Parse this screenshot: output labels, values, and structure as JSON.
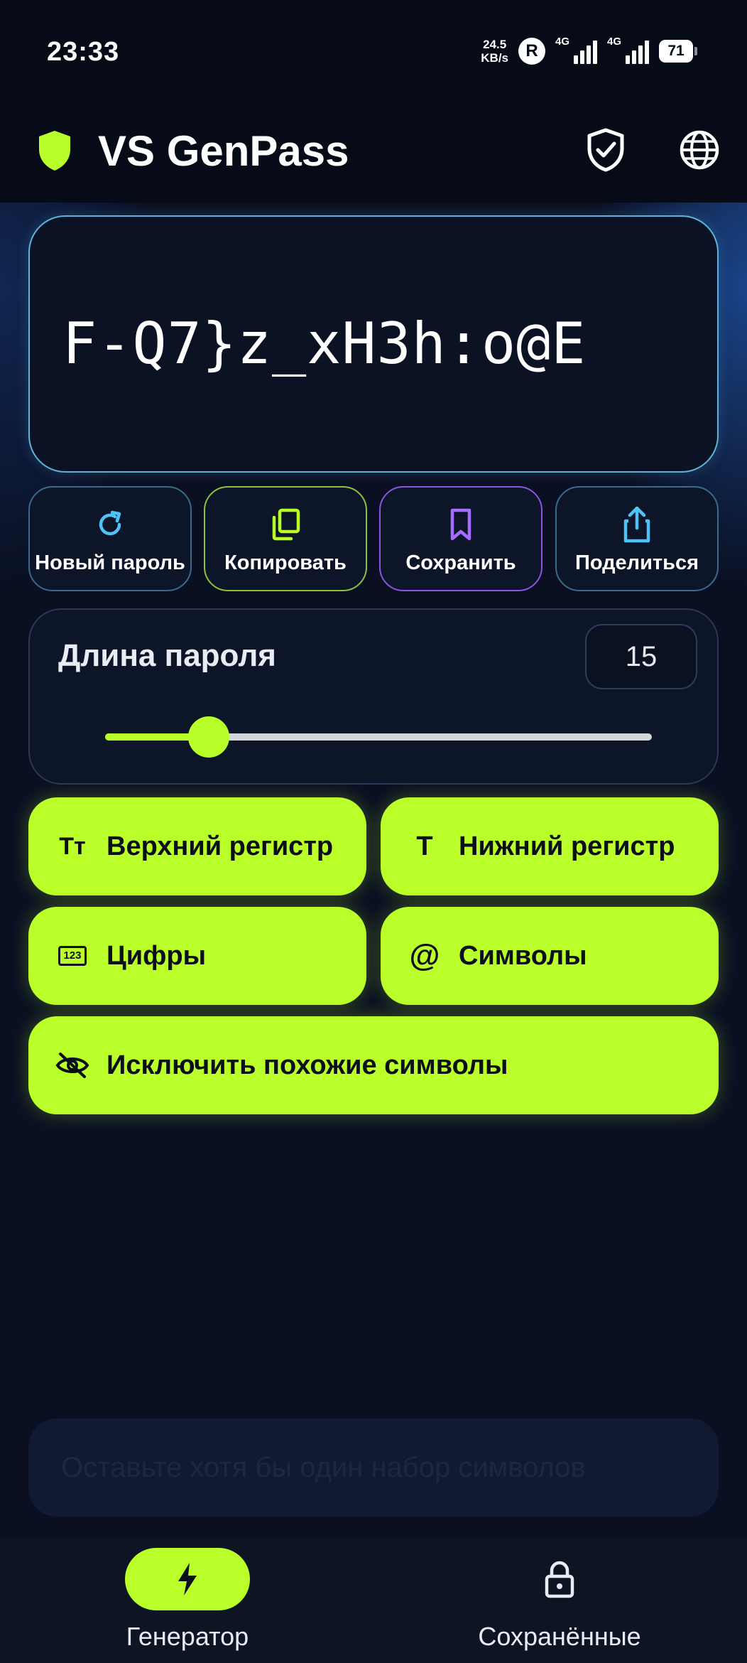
{
  "status_bar": {
    "time": "23:33",
    "net_speed_value": "24.5",
    "net_speed_unit": "KB/s",
    "roaming_badge": "R",
    "sim1_tag": "4G",
    "sim2_tag": "4G",
    "battery": "71"
  },
  "app_bar": {
    "title": "VS GenPass",
    "logo_icon": "shield-icon",
    "security_icon": "shield-check-icon",
    "language_icon": "globe-icon"
  },
  "password": {
    "value": "F-Q7}z_xH3h:o@E"
  },
  "actions": [
    {
      "label": "Новый пароль",
      "icon": "refresh-icon",
      "color": "#4fc3f7"
    },
    {
      "label": "Копировать",
      "icon": "copy-icon",
      "color": "#b8ff2a"
    },
    {
      "label": "Сохранить",
      "icon": "bookmark-icon",
      "color": "#a46cff"
    },
    {
      "label": "Поделиться",
      "icon": "share-icon",
      "color": "#4fc3f7"
    }
  ],
  "length": {
    "title": "Длина пароля",
    "value": "15",
    "slider_fraction": 0.19
  },
  "options": {
    "uppercase": {
      "label": "Верхний регистр",
      "icon": "Tт"
    },
    "lowercase": {
      "label": "Нижний регистр",
      "icon": "T"
    },
    "digits": {
      "label": "Цифры",
      "icon": "123"
    },
    "symbols": {
      "label": "Символы",
      "icon": "@"
    },
    "exclude_similar": {
      "label": "Исключить похожие символы",
      "icon": "eye-off-icon"
    }
  },
  "hint": {
    "text": "Оставьте хотя бы один набор символов"
  },
  "bottom_nav": [
    {
      "label": "Генератор",
      "icon": "bolt-icon",
      "active": true
    },
    {
      "label": "Сохранённые",
      "icon": "lock-icon",
      "active": false
    }
  ],
  "colors": {
    "accent": "#baff29",
    "background": "#070b18",
    "card": "#0d1528",
    "cyan": "#4fc3f7",
    "purple": "#a46cff"
  }
}
